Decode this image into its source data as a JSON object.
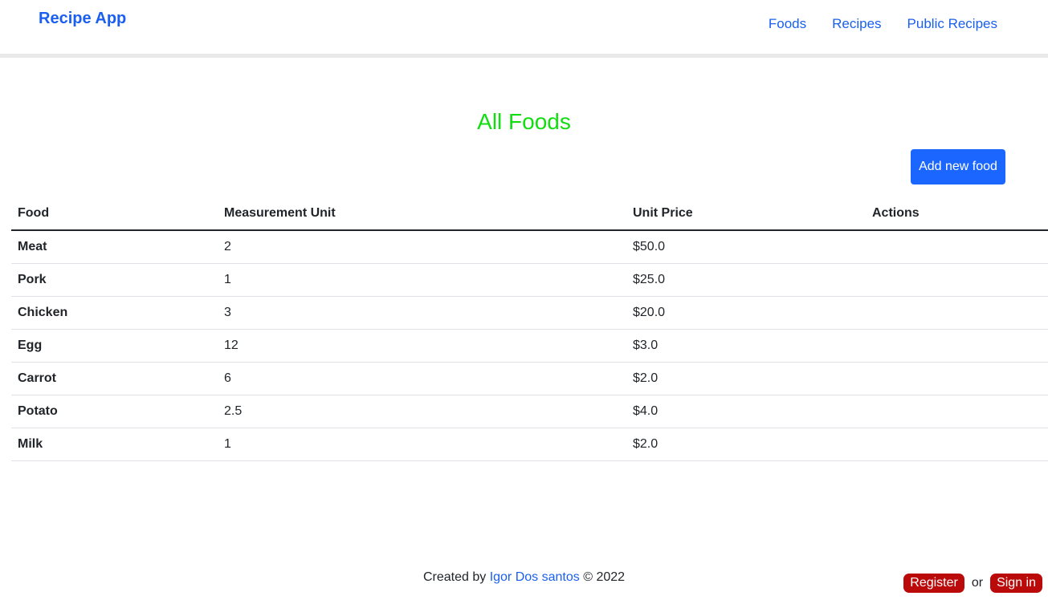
{
  "header": {
    "brand": "Recipe App",
    "nav": [
      "Foods",
      "Recipes",
      "Public Recipes"
    ]
  },
  "main": {
    "title": "All Foods",
    "add_button": "Add new food",
    "columns": [
      "Food",
      "Measurement Unit",
      "Unit Price",
      "Actions"
    ],
    "rows": [
      {
        "food": "Meat",
        "unit": "2",
        "price": "$50.0"
      },
      {
        "food": "Pork",
        "unit": "1",
        "price": "$25.0"
      },
      {
        "food": "Chicken",
        "unit": "3",
        "price": "$20.0"
      },
      {
        "food": "Egg",
        "unit": "12",
        "price": "$3.0"
      },
      {
        "food": "Carrot",
        "unit": "6",
        "price": "$2.0"
      },
      {
        "food": "Potato",
        "unit": "2.5",
        "price": "$4.0"
      },
      {
        "food": "Milk",
        "unit": "1",
        "price": "$2.0"
      }
    ]
  },
  "footer": {
    "created_by": "Created by",
    "author": "Igor Dos santos",
    "copyright": "© 2022",
    "register": "Register",
    "or": "or",
    "sign_in": "Sign in"
  },
  "colors": {
    "link": "#1a5ff0",
    "title": "#11dd11",
    "primary_button": "#1a66ff",
    "auth_button": "#bb0a0a"
  }
}
